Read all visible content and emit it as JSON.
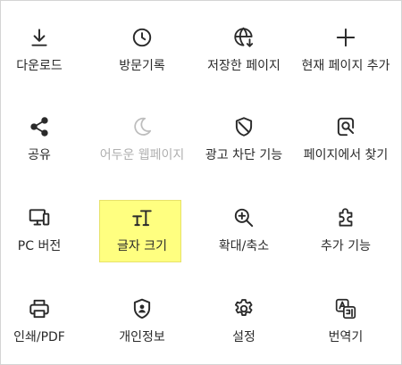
{
  "menu": {
    "items": [
      {
        "label": "다운로드",
        "icon": "download-icon"
      },
      {
        "label": "방문기록",
        "icon": "history-clock-icon"
      },
      {
        "label": "저장한 페이지",
        "icon": "saved-pages-globe-icon"
      },
      {
        "label": "현재 페이지 추가",
        "icon": "plus-icon"
      },
      {
        "label": "공유",
        "icon": "share-icon"
      },
      {
        "label": "어두운 웹페이지",
        "icon": "moon-icon",
        "disabled": true
      },
      {
        "label": "광고 차단 기능",
        "icon": "ad-block-shield-icon"
      },
      {
        "label": "페이지에서 찾기",
        "icon": "find-in-page-icon"
      },
      {
        "label": "PC 버전",
        "icon": "desktop-monitor-icon"
      },
      {
        "label": "글자 크기",
        "icon": "text-size-icon",
        "highlighted": true
      },
      {
        "label": "확대/축소",
        "icon": "zoom-icon"
      },
      {
        "label": "추가 기능",
        "icon": "puzzle-icon"
      },
      {
        "label": "인쇄/PDF",
        "icon": "print-icon"
      },
      {
        "label": "개인정보",
        "icon": "privacy-shield-icon"
      },
      {
        "label": "설정",
        "icon": "gear-icon"
      },
      {
        "label": "번역기",
        "icon": "translate-icon"
      }
    ],
    "highlight_color": "#ffff80",
    "disabled_color": "#b0b0b0"
  }
}
